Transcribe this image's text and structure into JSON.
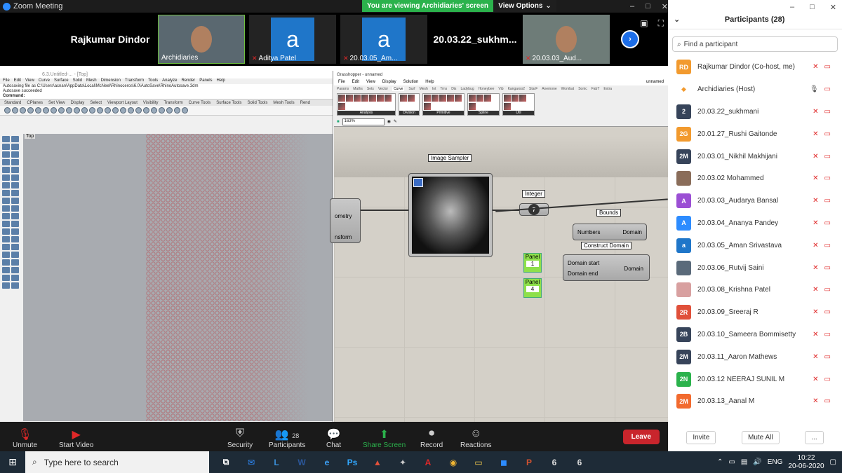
{
  "window": {
    "title": "Zoom Meeting",
    "min": "–",
    "max": "□",
    "close": "✕"
  },
  "banner": {
    "viewing": "You are viewing Archidiaries' screen",
    "options": "View Options"
  },
  "gallery": {
    "tiles": [
      {
        "name": "Rajkumar Dindor",
        "type": "name"
      },
      {
        "name": "Archidiaries",
        "type": "video",
        "muted": false
      },
      {
        "name": "Aditya Patel",
        "type": "avatar",
        "letter": "a"
      },
      {
        "name": "20.03.05_Am...",
        "type": "avatar",
        "letter": "a"
      },
      {
        "name": "20.03.22_sukhm...",
        "type": "name"
      },
      {
        "name": "20.03.03_Aud...",
        "type": "video"
      }
    ]
  },
  "rhino": {
    "title": "6.3.Untitled-... - [Top]",
    "menus": [
      "File",
      "Edit",
      "View",
      "Curve",
      "Surface",
      "Solid",
      "Mesh",
      "Dimension",
      "Transform",
      "Tools",
      "Analyze",
      "Render",
      "Panels",
      "Help"
    ],
    "log": [
      "Autosaving file as C:\\Users\\acnan\\AppData\\Local\\McNeel\\Rhinoceros\\6.0\\AutoSave\\RhinoAutosave.3dm",
      "Autosave succeeded",
      "Command:"
    ],
    "tabs": [
      "Standard",
      "CPlanes",
      "Set View",
      "Display",
      "Select",
      "Viewport Layout",
      "Visibility",
      "Transform",
      "Curve Tools",
      "Surface Tools",
      "Solid Tools",
      "Mesh Tools",
      "Rend"
    ],
    "viewport": "Top"
  },
  "grasshopper": {
    "title": "Grasshopper - unnamed",
    "doc": "unnamed",
    "menus": [
      "File",
      "Edit",
      "View",
      "Display",
      "Solution",
      "Help"
    ],
    "tabs": [
      "Params",
      "Maths",
      "Sets",
      "Vector",
      "Curve",
      "Surf",
      "Mesh",
      "Int",
      "Trns",
      "Dis",
      "Ladybug",
      "Honeybee",
      "Vib",
      "Kangaroo2",
      "StarF",
      "Anemone",
      "Wombat",
      "Sonic",
      "FabT",
      "Extra"
    ],
    "groups": [
      "Analysis",
      "Division",
      "Primitive",
      "Spline",
      "Util"
    ],
    "zoom": "163%",
    "labels": {
      "sampler": "Image Sampler",
      "integer": "Integer",
      "bounds": "Bounds",
      "construct": "Construct Domain"
    },
    "geometry": "ometry",
    "transform": "nsform",
    "integer_value": "7",
    "numbers": "Numbers",
    "domain": "Domain",
    "domain_start": "Domain start",
    "domain_end": "Domain end",
    "panel": "Panel",
    "panel1": "1",
    "panel2": "4"
  },
  "toolbar": {
    "unmute": "Unmute",
    "start_video": "Start Video",
    "security": "Security",
    "participants": "Participants",
    "participants_count": "28",
    "chat": "Chat",
    "share": "Share Screen",
    "record": "Record",
    "reactions": "Reactions",
    "leave": "Leave"
  },
  "panel": {
    "title": "Participants (28)",
    "search_placeholder": "Find a participant",
    "participants": [
      {
        "initials": "RD",
        "name": "Rajkumar Dindor (Co-host, me)",
        "color": "#f29a2e"
      },
      {
        "initials": "",
        "name": "Archidiaries (Host)",
        "color": "#888888",
        "host": true
      },
      {
        "initials": "2",
        "name": "20.03.22_sukhmani",
        "color": "#37445a"
      },
      {
        "initials": "2G",
        "name": "20.01.27_Rushi Gaitonde",
        "color": "#f29a2e"
      },
      {
        "initials": "2M",
        "name": "20.03.01_Nikhil Makhijani",
        "color": "#37445a"
      },
      {
        "initials": "",
        "name": "20.03.02 Mohammed",
        "color": "#8a6d5a",
        "photo": true
      },
      {
        "initials": "A",
        "name": "20.03.03_Audarya Bansal",
        "color": "#9b4fd4"
      },
      {
        "initials": "A",
        "name": "20.03.04_Ananya Pandey",
        "color": "#2d8cff"
      },
      {
        "initials": "a",
        "name": "20.03.05_Aman Srivastava",
        "color": "#1f76c9"
      },
      {
        "initials": "",
        "name": "20.03.06_Rutvij Saini",
        "color": "#5a6a7a",
        "photo": true
      },
      {
        "initials": "",
        "name": "20.03.08_Krishna Patel",
        "color": "#d8a0a0",
        "photo": true
      },
      {
        "initials": "2R",
        "name": "20.03.09_Sreeraj R",
        "color": "#e0503a"
      },
      {
        "initials": "2B",
        "name": "20.03.10_Sameera Bommisetty",
        "color": "#37445a"
      },
      {
        "initials": "2M",
        "name": "20.03.11_Aaron Mathews",
        "color": "#37445a"
      },
      {
        "initials": "2N",
        "name": "20.03.12 NEERAJ SUNIL M",
        "color": "#2bb24c"
      },
      {
        "initials": "2M",
        "name": "20.03.13_Aanal M",
        "color": "#f26a2e"
      }
    ],
    "invite": "Invite",
    "mute_all": "Mute All",
    "more": "..."
  },
  "taskbar": {
    "search": "Type here to search",
    "apps": [
      {
        "name": "task-view",
        "label": "⧉",
        "color": "#fff"
      },
      {
        "name": "mail",
        "label": "✉",
        "color": "#2d8cff"
      },
      {
        "name": "lens",
        "label": "L",
        "color": "#3a8fd8"
      },
      {
        "name": "word",
        "label": "W",
        "color": "#2b579a"
      },
      {
        "name": "edge",
        "label": "e",
        "color": "#3ea6ff"
      },
      {
        "name": "photoshop",
        "label": "Ps",
        "color": "#31a8ff"
      },
      {
        "name": "sketchup",
        "label": "▲",
        "color": "#e0503a"
      },
      {
        "name": "grasshopper",
        "label": "✦",
        "color": "#ccc"
      },
      {
        "name": "acrobat",
        "label": "A",
        "color": "#e02828"
      },
      {
        "name": "chrome",
        "label": "◉",
        "color": "#f2b632"
      },
      {
        "name": "explorer",
        "label": "▭",
        "color": "#f2c94c"
      },
      {
        "name": "zoom",
        "label": "◼",
        "color": "#2d8cff"
      },
      {
        "name": "powerpoint",
        "label": "P",
        "color": "#d35230"
      },
      {
        "name": "rhino-a",
        "label": "6",
        "color": "#ddd"
      },
      {
        "name": "rhino-b",
        "label": "6",
        "color": "#ddd"
      }
    ],
    "lang": "ENG",
    "time": "10:22",
    "date": "20-06-2020"
  }
}
